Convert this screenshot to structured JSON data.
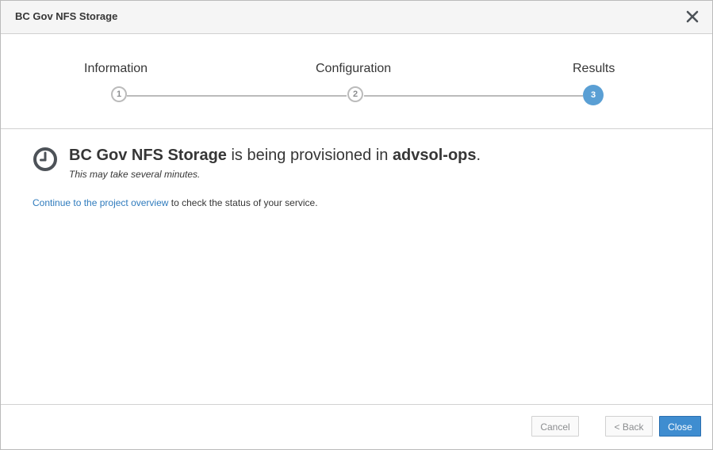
{
  "dialog": {
    "title": "BC Gov NFS Storage"
  },
  "wizard": {
    "steps": [
      {
        "label": "Information",
        "number": "1",
        "state": "complete"
      },
      {
        "label": "Configuration",
        "number": "2",
        "state": "complete"
      },
      {
        "label": "Results",
        "number": "3",
        "state": "active"
      }
    ]
  },
  "result": {
    "service_name": "BC Gov NFS Storage",
    "middle_text": " is being provisioned in ",
    "project_name": "advsol-ops",
    "end_punct": ".",
    "note": "This may take several minutes.",
    "link_text": "Continue to the project overview",
    "link_suffix": " to check the status of your service."
  },
  "footer": {
    "cancel_label": "Cancel",
    "back_label": "< Back",
    "close_label": "Close"
  },
  "colors": {
    "active_step": "#5a9fd4",
    "link": "#2f7bbd",
    "primary_button": "#3f8dd0"
  },
  "icons": {
    "close": "close-icon",
    "status": "clock-icon"
  }
}
